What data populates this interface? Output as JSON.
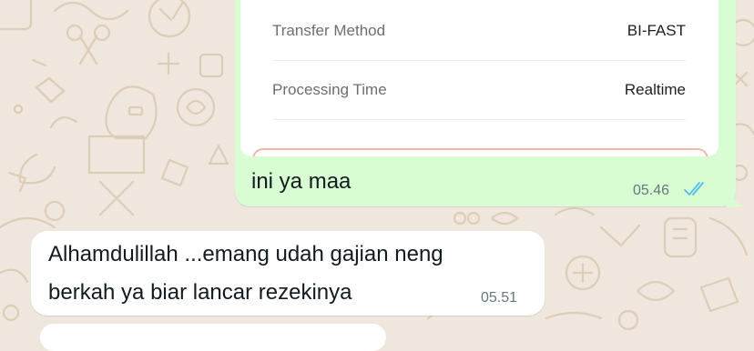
{
  "chat": {
    "outgoing": {
      "receipt": {
        "rows": [
          {
            "label": "Transfer Method",
            "value": "BI-FAST"
          },
          {
            "label": "Processing Time",
            "value": "Realtime"
          }
        ]
      },
      "text": "ini ya maa",
      "time": "05.46",
      "status_icon": "double-check-icon",
      "status_color": "#53bdeb"
    },
    "incoming": {
      "lines": [
        "Alhamdulillah ...emang udah gajian neng",
        "berkah ya biar lancar rezekinya"
      ],
      "time": "05.51"
    }
  },
  "colors": {
    "wallpaper": "#efe7dd",
    "outgoing_bubble": "#d9fdd3",
    "incoming_bubble": "#ffffff"
  }
}
